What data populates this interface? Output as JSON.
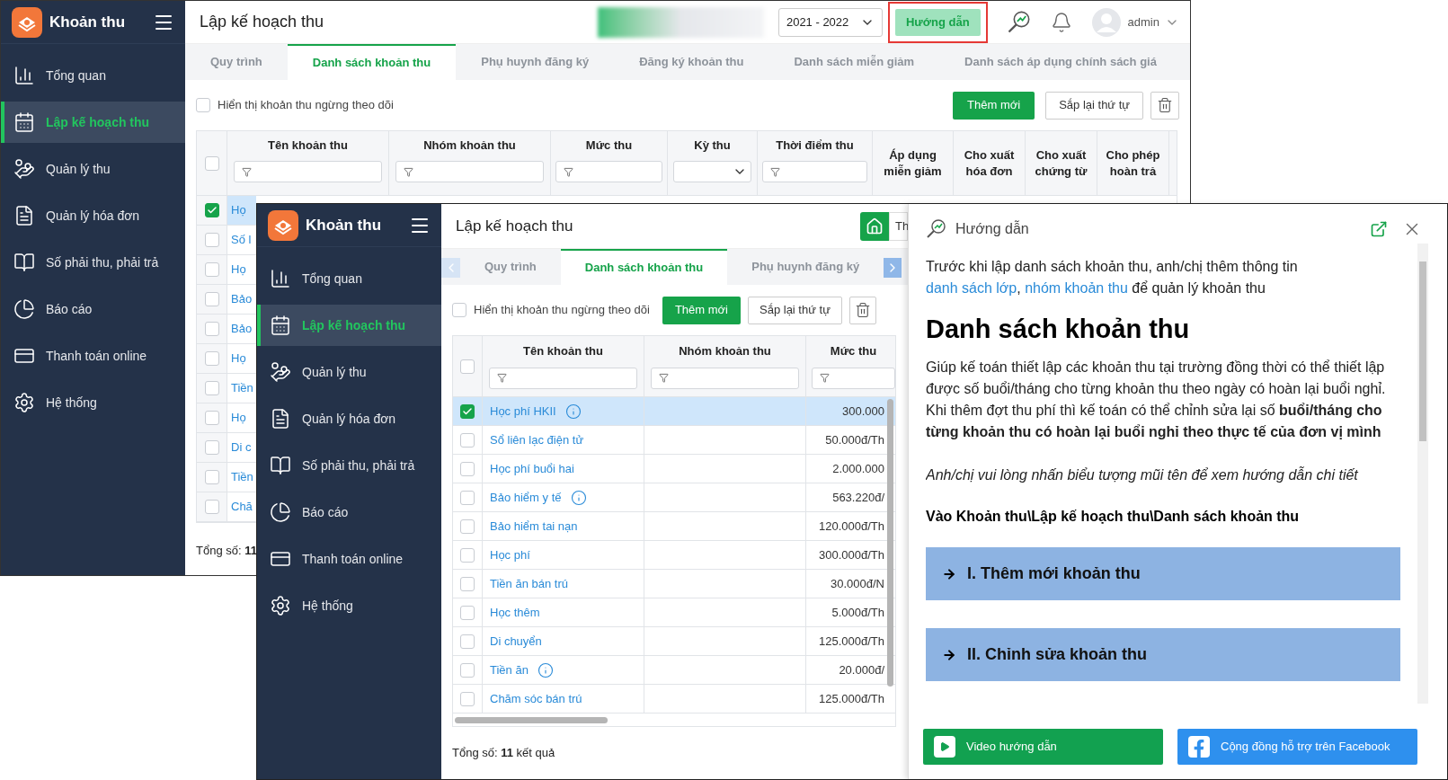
{
  "back_window": {
    "sidebar": {
      "title": "Khoản thu",
      "items": [
        {
          "label": "Tổng quan",
          "selected": false
        },
        {
          "label": "Lập kế hoạch thu",
          "selected": true
        },
        {
          "label": "Quản lý thu",
          "selected": false
        },
        {
          "label": "Quản lý hóa đơn",
          "selected": false
        },
        {
          "label": "Số phải thu, phải trả",
          "selected": false
        },
        {
          "label": "Báo cáo",
          "selected": false
        },
        {
          "label": "Thanh toán online",
          "selected": false
        },
        {
          "label": "Hệ thống",
          "selected": false
        }
      ]
    },
    "header": {
      "title": "Lập kế hoạch thu",
      "school_year": "2021 - 2022",
      "guide_button": {
        "label": "Hướng dẫn",
        "highlighted": true
      },
      "user": "admin"
    },
    "tabs": [
      {
        "label": "Quy trình",
        "selected": false
      },
      {
        "label": "Danh sách khoản thu",
        "selected": true
      },
      {
        "label": "Phụ huynh đăng ký",
        "selected": false
      },
      {
        "label": "Đăng ký khoản thu",
        "selected": false
      },
      {
        "label": "Danh sách miễn giảm",
        "selected": false
      },
      {
        "label": "Danh sách áp dụng chính sách giá",
        "selected": false
      }
    ],
    "toolbar": {
      "show_inactive": {
        "label": "Hiển thị khoản thu ngừng theo dõi",
        "checked": false
      },
      "add_button": "Thêm mới",
      "reorder_button": "Sắp lại thứ tự"
    },
    "table": {
      "select_all_checked": false,
      "columns": [
        {
          "label": "Tên khoản thu",
          "kind": "text-filter"
        },
        {
          "label": "Nhóm khoản thu",
          "kind": "text-filter"
        },
        {
          "label": "Mức thu",
          "kind": "text-filter"
        },
        {
          "label": "Kỳ thu",
          "kind": "select-filter"
        },
        {
          "label": "Thời điểm thu",
          "kind": "text-filter"
        },
        {
          "label": "Áp dụng miễn giảm",
          "kind": "plain"
        },
        {
          "label": "Cho xuất hóa đơn",
          "kind": "plain"
        },
        {
          "label": "Cho xuất chứng từ",
          "kind": "plain"
        },
        {
          "label": "Cho phép hoàn trả",
          "kind": "plain"
        }
      ],
      "rows": [
        {
          "checked": true,
          "name": "Họ"
        },
        {
          "checked": false,
          "name": "Số l"
        },
        {
          "checked": false,
          "name": "Họ"
        },
        {
          "checked": false,
          "name": "Bảo"
        },
        {
          "checked": false,
          "name": "Bảo"
        },
        {
          "checked": false,
          "name": "Họ"
        },
        {
          "checked": false,
          "name": "Tiền"
        },
        {
          "checked": false,
          "name": "Họ"
        },
        {
          "checked": false,
          "name": "Di c"
        },
        {
          "checked": false,
          "name": "Tiền"
        },
        {
          "checked": false,
          "name": "Chă"
        }
      ]
    },
    "footer": "Tổng số: **11**"
  },
  "front_window": {
    "sidebar": {
      "title": "Khoản thu",
      "items": [
        {
          "label": "Tổng quan",
          "selected": false
        },
        {
          "label": "Lập kế hoạch thu",
          "selected": true
        },
        {
          "label": "Quản lý thu",
          "selected": false
        },
        {
          "label": "Quản lý hóa đơn",
          "selected": false
        },
        {
          "label": "Số phải thu, phải trả",
          "selected": false
        },
        {
          "label": "Báo cáo",
          "selected": false
        },
        {
          "label": "Thanh toán online",
          "selected": false
        },
        {
          "label": "Hệ thống",
          "selected": false
        }
      ]
    },
    "header": {
      "title": "Lập kế hoạch thu",
      "button_text": "Th"
    },
    "tabs": [
      {
        "label": "Quy trình",
        "selected": false
      },
      {
        "label": "Danh sách khoản thu",
        "selected": true
      },
      {
        "label": "Phụ huynh đăng ký",
        "selected": false
      }
    ],
    "toolbar": {
      "show_inactive": {
        "label": "Hiển thị khoản thu ngừng theo dõi",
        "checked": false
      },
      "add_button": "Thêm mới",
      "reorder_button": "Sắp lại thứ tự"
    },
    "table": {
      "select_all_checked": false,
      "columns": [
        {
          "label": "Tên khoản thu"
        },
        {
          "label": "Nhóm khoản thu"
        },
        {
          "label": "Mức thu"
        }
      ],
      "rows": [
        {
          "checked": true,
          "name": "Học phí HKII",
          "info": true,
          "amount": "300.000"
        },
        {
          "checked": false,
          "name": "Sổ liên lạc điện tử",
          "info": false,
          "amount": "50.000đ/Th"
        },
        {
          "checked": false,
          "name": "Học phí buổi hai",
          "info": false,
          "amount": "2.000.000"
        },
        {
          "checked": false,
          "name": "Bảo hiểm y tế",
          "info": true,
          "amount": "563.220đ/"
        },
        {
          "checked": false,
          "name": "Bảo hiểm tai nạn",
          "info": false,
          "amount": "120.000đ/Th"
        },
        {
          "checked": false,
          "name": "Học phí",
          "info": false,
          "amount": "300.000đ/Th"
        },
        {
          "checked": false,
          "name": "Tiền ăn bán trú",
          "info": false,
          "amount": "30.000đ/N"
        },
        {
          "checked": false,
          "name": "Học thêm",
          "info": false,
          "amount": "5.000đ/Th"
        },
        {
          "checked": false,
          "name": "Di chuyển",
          "info": false,
          "amount": "125.000đ/Th"
        },
        {
          "checked": false,
          "name": "Tiền ăn",
          "info": true,
          "amount": "20.000đ/"
        },
        {
          "checked": false,
          "name": "Chăm sóc bán trú",
          "info": false,
          "amount": "125.000đ/Th"
        }
      ]
    },
    "footer": "Tổng số: **11** kết quả"
  },
  "guide": {
    "title": "Hướng dẫn",
    "intro": [
      {
        "kind": "text",
        "text": "Trước khi lập danh sách khoản thu, anh/chị thêm thông tin "
      },
      {
        "kind": "link",
        "text": "danh sách lớp"
      },
      {
        "kind": "text",
        "text": ", "
      },
      {
        "kind": "link",
        "text": "nhóm khoản thu"
      },
      {
        "kind": "text",
        "text": " để quản lý khoản thu"
      }
    ],
    "heading": "Danh sách khoản thu",
    "description": "Giúp kế toán thiết lập các khoản thu tại trường đồng thời có thể thiết lập được số buổi/tháng cho từng khoản thu theo ngày có hoàn lại buổi nghỉ. Khi thêm đợt thu phí thì kế toán có thể chỉnh sửa lại số **buổi/tháng cho từng khoản thu có hoàn lại buổi nghỉ theo thực tế của đơn vị mình**",
    "note": "Anh/chị vui lòng nhấn biểu tượng mũi tên để xem hướng dẫn chi tiết",
    "path": "Vào Khoản thu\\Lập kế hoạch thu\\Danh sách khoản thu",
    "sections": [
      {
        "label": "I. Thêm mới khoản thu"
      },
      {
        "label": "II. Chỉnh sửa khoản thu"
      }
    ],
    "video_button": "Video hướng dẫn",
    "facebook_button": "Cộng đồng hỗ trợ trên Facebook"
  }
}
